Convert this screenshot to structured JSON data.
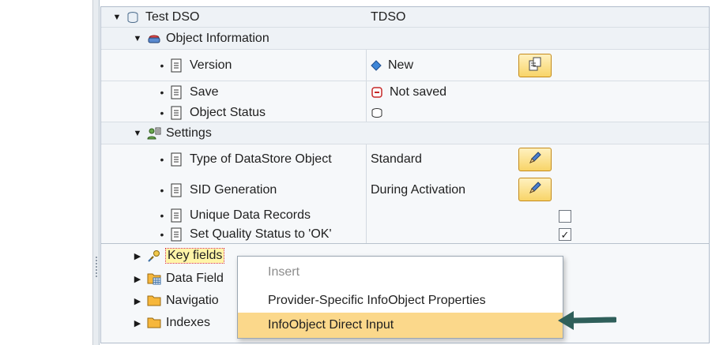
{
  "tree": {
    "root": {
      "label": "Test DSO",
      "value": "TDSO"
    },
    "object_information": {
      "label": "Object Information",
      "items": [
        {
          "label": "Version",
          "value": "New"
        },
        {
          "label": "Save",
          "value": "Not saved"
        },
        {
          "label": "Object Status",
          "value": ""
        }
      ]
    },
    "settings": {
      "label": "Settings",
      "items": [
        {
          "label": "Type of DataStore Object",
          "value": "Standard"
        },
        {
          "label": "SID Generation",
          "value": "During Activation"
        },
        {
          "label": "Unique Data Records",
          "value": "",
          "checked": false
        },
        {
          "label": "Set Quality Status to 'OK'",
          "value": "",
          "checked": true
        }
      ]
    },
    "key_fields": {
      "label": "Key fields"
    },
    "data_fields": {
      "label": "Data Field"
    },
    "navigation": {
      "label": "Navigatio"
    },
    "indexes": {
      "label": "Indexes"
    }
  },
  "context_menu": {
    "items": [
      {
        "label": "Insert",
        "enabled": false
      },
      {
        "label": "Provider-Specific InfoObject Properties",
        "enabled": true
      },
      {
        "label": "InfoObject Direct Input",
        "enabled": true,
        "hovered": true
      }
    ]
  },
  "colors": {
    "button_fill": "#f8d468",
    "menu_hover": "#fbd88b",
    "arrow": "#2f5f5a"
  }
}
